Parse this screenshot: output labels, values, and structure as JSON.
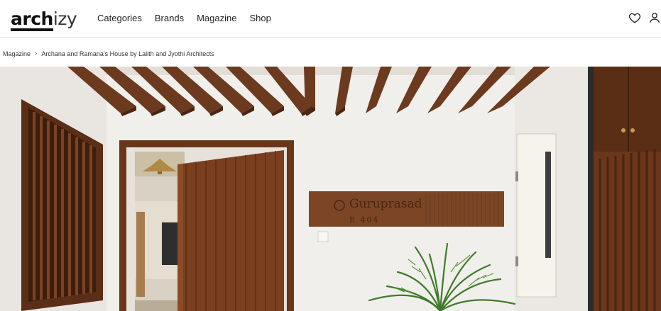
{
  "header": {
    "logo_bold": "arch",
    "logo_light": "izy",
    "nav": [
      {
        "label": "Categories"
      },
      {
        "label": "Brands"
      },
      {
        "label": "Magazine"
      },
      {
        "label": "Shop"
      }
    ]
  },
  "breadcrumb": {
    "root": "Magazine",
    "current": "Archana and Ramana's House by Lalith and Jyothi Architects"
  },
  "hero": {
    "nameplate_line1": "Guruprasad",
    "nameplate_line2": "E 404"
  }
}
